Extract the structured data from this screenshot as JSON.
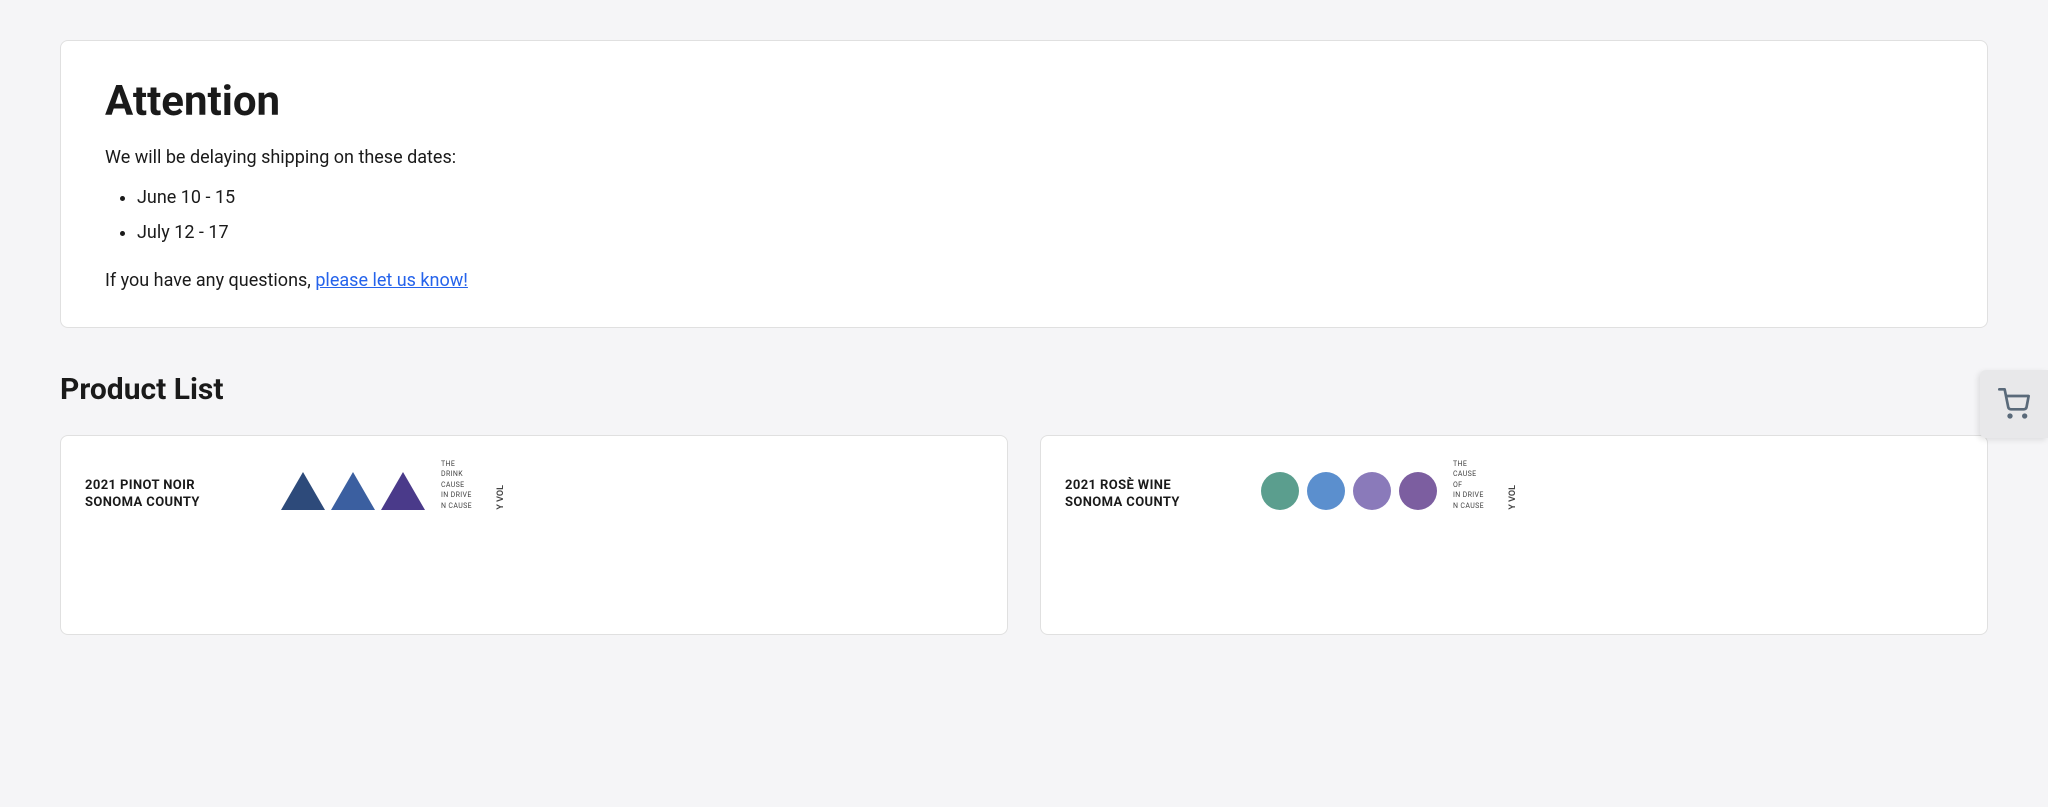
{
  "attention": {
    "title": "Attention",
    "intro": "We will be delaying shipping on these dates:",
    "dates": [
      "June 10 - 15",
      "July 12 - 17"
    ],
    "footer_prefix": "If you have any questions, ",
    "footer_link_text": "please let us know!",
    "footer_link_href": "#"
  },
  "product_list": {
    "section_title": "Product List",
    "products": [
      {
        "id": "pinot-noir",
        "name": "2021 PINOT NOIR",
        "region": "SONOMA COUNTY",
        "type": "triangles",
        "side_labels": [
          "THE",
          "DRINK",
          "CAUSE",
          "IN DRIVE",
          "N CAUSE"
        ],
        "vol_label": "Y VOL"
      },
      {
        "id": "rose-wine",
        "name": "2021 ROSÈ WINE",
        "region": "SONOMA COUNTY",
        "type": "circles",
        "side_labels": [
          "THE",
          "CAUSE",
          "OF",
          "IN DRIVE",
          "N CAUSE"
        ],
        "vol_label": "Y VOL"
      }
    ]
  },
  "cart": {
    "label": "Shopping Cart"
  }
}
